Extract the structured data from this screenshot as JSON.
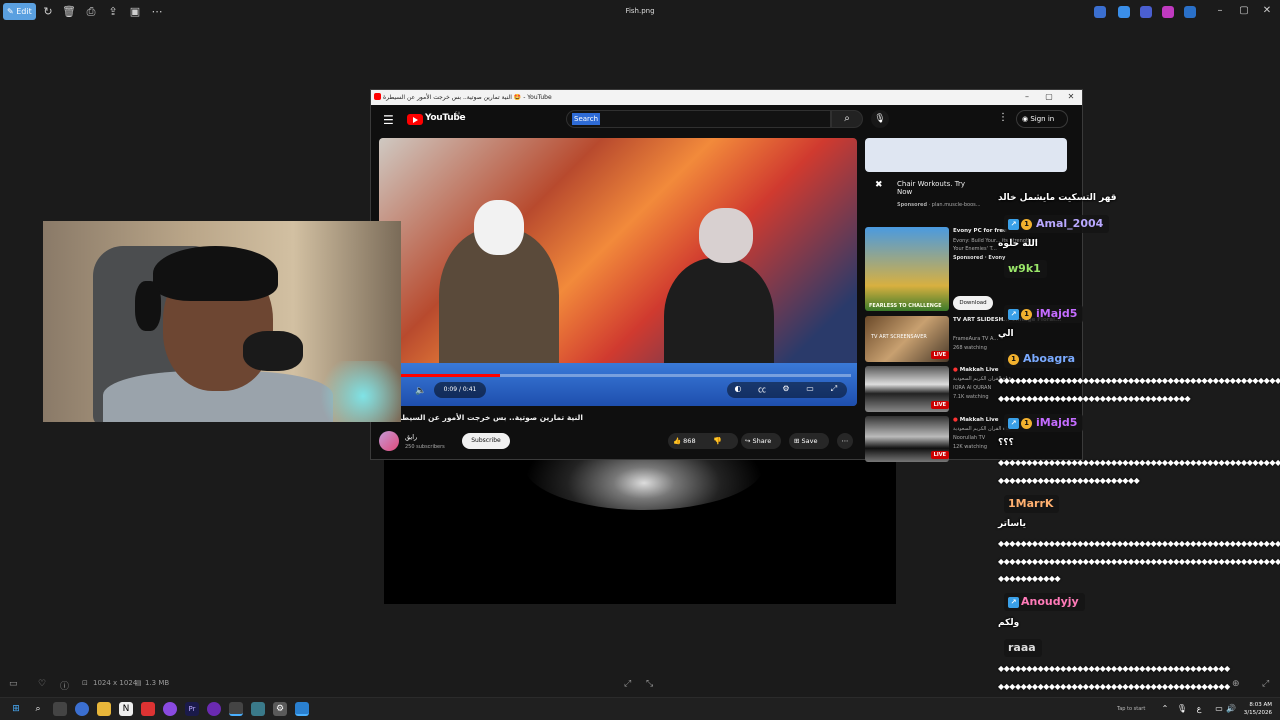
{
  "viewer": {
    "edit_label": "Edit",
    "file_title": "Fish.png",
    "status": {
      "dimensions": "1024 x 1024",
      "size": "1.3 MB"
    }
  },
  "youtube": {
    "tab_title": "النية تمارين صوتية.. بس خرجت الأمور عن السيطرة 🤩 - YouTube",
    "logo_text": "YouTube",
    "logo_region": "SA",
    "search_placeholder": "Search",
    "signin_label": "Sign in",
    "video": {
      "time": "0:09 / 0:41",
      "progress": 0.22,
      "title": "النية تمارين صوتية.. بس خرجت الأمور عن السيطرة 🤩",
      "channel": "رايق",
      "subscribers": "250 subscribers",
      "subscribe_label": "Subscribe",
      "likes": "868",
      "share_label": "Share",
      "save_label": "Save"
    },
    "ad": {
      "title": "Chair Workouts. Try Now",
      "sponsor": "Sponsored",
      "domain": "· plan.muscle-boos..."
    },
    "recommendations": [
      {
        "title": "Evony PC for free",
        "sub1": "Evony: Build Your... its Strength at",
        "sub2": "Your Enemies' T...",
        "sub3": "Sponsored · Evony",
        "button": "Download",
        "thumb_text": "FEARLESS TO CHALLENGE"
      },
      {
        "title": "TV ART SLIDESH... Vintage Floral...",
        "sub1": "FrameAura TV A...",
        "sub2": "268 watching",
        "badge": "LIVE",
        "thumb_text": "TV ART SCREENSAVER"
      },
      {
        "title": "Makkah Live",
        "sub1": "قناة القرآن الكريم السعودية",
        "sub2": "IQRA AI QURAN",
        "sub3": "7.1K watching",
        "badge": "LIVE"
      },
      {
        "title": "Makkah Live",
        "sub1": "قناة القرآن الكريم السعودية",
        "sub2": "Noorullah TV",
        "sub3": "12K watching",
        "badge": "LIVE"
      }
    ]
  },
  "chat": {
    "messages": [
      {
        "type": "text",
        "text": "قهر التسكيت مايشمل خالد"
      },
      {
        "type": "user",
        "name": "Amal_2004",
        "color": "#b9a8ff",
        "badges": [
          "a",
          "b"
        ]
      },
      {
        "type": "text",
        "text": "الله حلوه"
      },
      {
        "type": "user",
        "name": "w9k1",
        "color": "#9be86a",
        "badges": []
      },
      {
        "type": "user",
        "name": "iMajd5",
        "color": "#c46cff",
        "badges": [
          "a",
          "b"
        ]
      },
      {
        "type": "text",
        "text": "الي"
      },
      {
        "type": "user",
        "name": "Aboagra",
        "color": "#7aaaff",
        "badges": [
          "b"
        ]
      },
      {
        "type": "hash",
        "text": "◆◆◆◆◆◆◆◆◆◆◆◆◆◆◆◆◆◆◆◆◆◆◆◆◆◆◆◆◆◆◆◆◆◆◆◆◆◆◆◆◆◆◆◆◆◆◆◆◆◆◆"
      },
      {
        "type": "hash",
        "text": "◆◆◆◆◆◆◆◆◆◆◆◆◆◆◆◆◆◆◆◆◆◆◆◆◆◆◆◆◆◆◆◆◆◆"
      },
      {
        "type": "user",
        "name": "iMajd5",
        "color": "#c46cff",
        "badges": [
          "a",
          "b"
        ]
      },
      {
        "type": "text",
        "text": "؟؟؟"
      },
      {
        "type": "hash",
        "text": "◆◆◆◆◆◆◆◆◆◆◆◆◆◆◆◆◆◆◆◆◆◆◆◆◆◆◆◆◆◆◆◆◆◆◆◆◆◆◆◆◆◆◆◆◆◆◆◆◆◆◆"
      },
      {
        "type": "hash",
        "text": "◆◆◆◆◆◆◆◆◆◆◆◆◆◆◆◆◆◆◆◆◆◆◆◆◆"
      },
      {
        "type": "user",
        "name": "1MarrK",
        "color": "#ffb070",
        "badges": []
      },
      {
        "type": "text",
        "text": "ياساتر"
      },
      {
        "type": "hash",
        "text": "◆◆◆◆◆◆◆◆◆◆◆◆◆◆◆◆◆◆◆◆◆◆◆◆◆◆◆◆◆◆◆◆◆◆◆◆◆◆◆◆◆◆◆◆◆◆◆◆◆◆◆"
      },
      {
        "type": "hash",
        "text": "◆◆◆◆◆◆◆◆◆◆◆◆◆◆◆◆◆◆◆◆◆◆◆◆◆◆◆◆◆◆◆◆◆◆◆◆◆◆◆◆◆◆◆◆◆◆◆◆◆◆◆"
      },
      {
        "type": "hash",
        "text": "◆◆◆◆◆◆◆◆◆◆◆"
      },
      {
        "type": "user",
        "name": "Anoudyjy",
        "color": "#ff7ab8",
        "badges": [
          "a"
        ]
      },
      {
        "type": "text",
        "text": "ولكم"
      },
      {
        "type": "user",
        "name": "raaa",
        "color": "#dddddd",
        "badges": []
      },
      {
        "type": "hash",
        "text": "◆◆◆◆◆◆◆◆◆◆◆◆◆◆◆◆◆◆◆◆◆◆◆◆◆◆◆◆◆◆◆◆◆◆◆◆◆◆◆◆◆"
      },
      {
        "type": "hash",
        "text": "◆◆◆◆◆◆◆◆◆◆◆◆◆◆◆◆◆◆◆◆◆◆◆◆◆◆◆◆◆◆◆◆◆◆◆◆◆◆◆◆◆"
      },
      {
        "type": "hash",
        "text": "◆◆◆◆◆◆◆◆◆◆◆◆◆◆◆◆◆◆◆◆◆◆◆◆◆◆◆◆◆◆◆◆◆◆◆◆◆◆◆◆◆"
      }
    ]
  },
  "taskbar": {
    "tap_to_start": "Tap to start",
    "time": "8:03 AM",
    "date": "3/15/2026",
    "lang": "ع"
  }
}
